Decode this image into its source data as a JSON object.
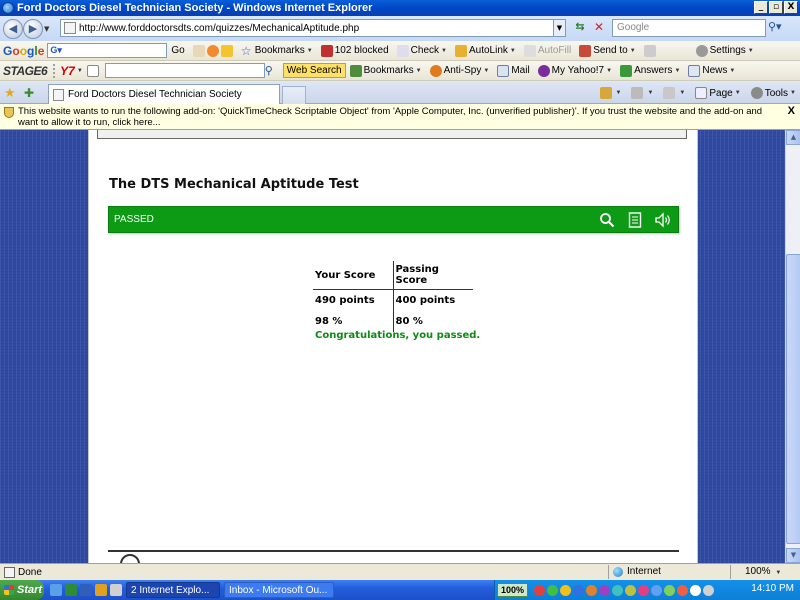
{
  "window": {
    "title": "Ford Doctors Diesel Technician Society - Windows Internet Explorer",
    "buttons": [
      "_",
      "▫",
      "X"
    ]
  },
  "address_bar": {
    "url": "http://www.forddoctorsdts.com/quizzes/MechanicalAptitude.php",
    "search_placeholder": "Google"
  },
  "google_toolbar": {
    "logo": "Google",
    "go": "Go",
    "bookmarks": "Bookmarks",
    "blocked": "102 blocked",
    "check": "Check",
    "autolink": "AutoLink",
    "autofill": "AutoFill",
    "send_to": "Send to",
    "settings": "Settings"
  },
  "yahoo_toolbar": {
    "stage6": "STAGE6",
    "y7": "Y7",
    "web_search": "Web Search",
    "bookmarks": "Bookmarks",
    "anti_spy": "Anti-Spy",
    "mail": "Mail",
    "my_yahoo": "My Yahoo!7",
    "answers": "Answers",
    "news": "News"
  },
  "tabs": [
    {
      "label": "Ford Doctors Diesel Technician Society"
    }
  ],
  "command_bar": {
    "page": "Page",
    "tools": "Tools"
  },
  "info_bar": {
    "message": "This website wants to run the following add-on: 'QuickTimeCheck Scriptable Object' from 'Apple Computer, Inc. (unverified publisher)'. If you trust the website and the add-on and want to allow it to run, click here...",
    "close": "X"
  },
  "quiz": {
    "title": "The DTS Mechanical Aptitude Test",
    "status": "PASSED",
    "table": {
      "headers": [
        "Your Score",
        "Passing Score"
      ],
      "rows": [
        [
          "490 points",
          "400 points"
        ],
        [
          "98 %",
          "80 %"
        ]
      ]
    },
    "message": "Congratulations, you passed."
  },
  "status_bar": {
    "text": "Done",
    "zone": "Internet",
    "zoom": "100%"
  },
  "taskbar": {
    "start": "Start",
    "tasks": [
      "2 Internet Explo...",
      "Inbox - Microsoft Ou..."
    ],
    "battery": "100%",
    "clock": "14:10 PM"
  },
  "colors": {
    "pass_green": "#0d9a14",
    "page_background": "#2f4aa3",
    "info_bar": "#ffffe1"
  }
}
